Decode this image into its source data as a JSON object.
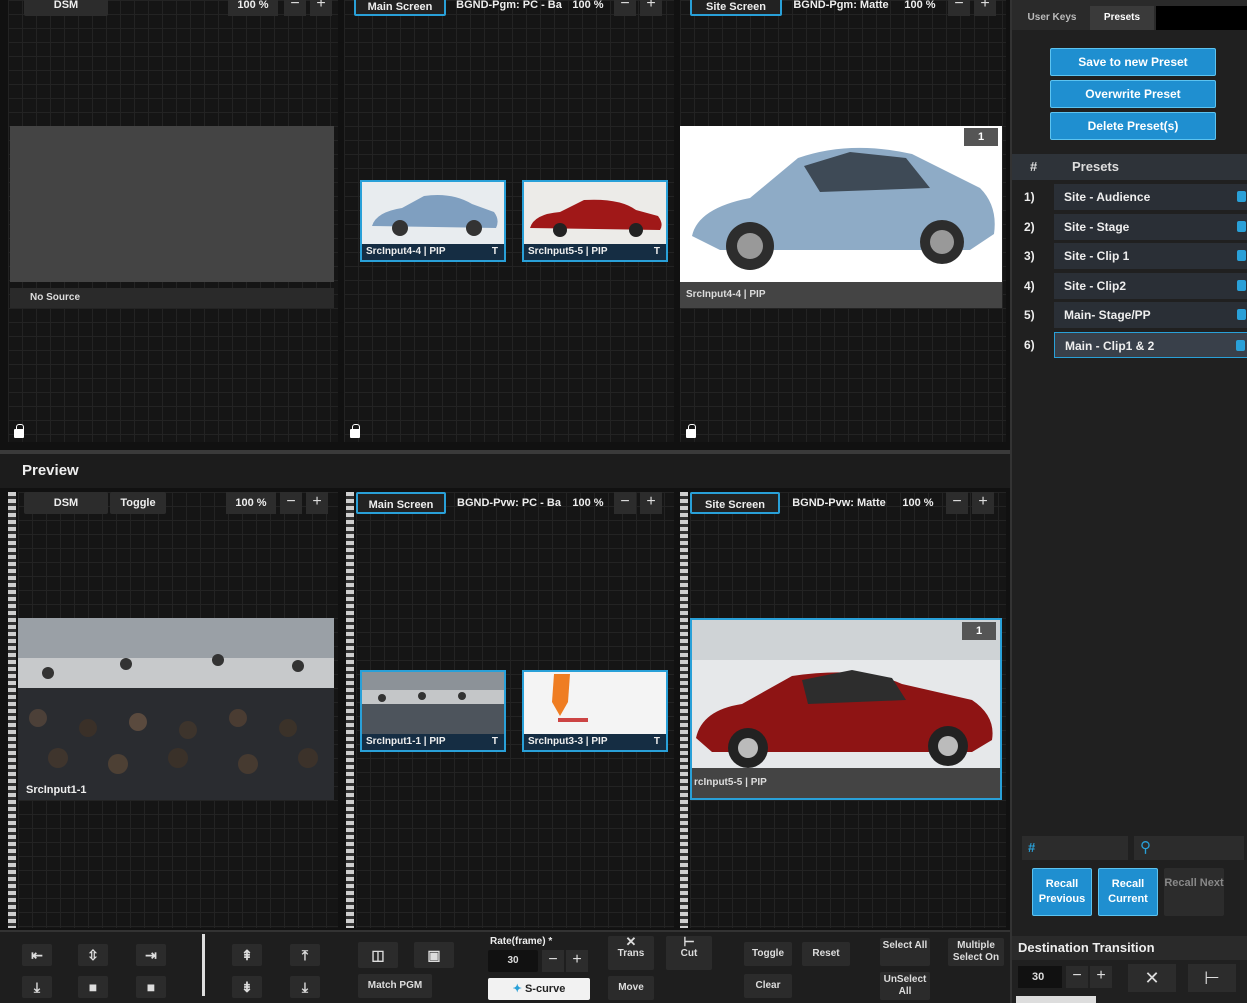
{
  "program": {
    "panels": [
      {
        "screen": "DSM",
        "zoom": "100 %",
        "nosource": "No Source"
      },
      {
        "screen": "Main Screen",
        "bgnd": "BGND-Pgm: PC - Ba",
        "zoom": "100 %",
        "pips": [
          {
            "label": "SrcInput4-4 | PIP",
            "t": "T"
          },
          {
            "label": "SrcInput5-5 | PIP",
            "t": "T"
          }
        ]
      },
      {
        "screen": "Site Screen",
        "bgnd": "BGND-Pgm: Matte",
        "zoom": "100 %",
        "layer_num": "1",
        "label": "SrcInput4-4 | PIP"
      }
    ]
  },
  "preview": {
    "title": "Preview",
    "panels": [
      {
        "screen": "DSM",
        "toggle": "Toggle",
        "zoom": "100 %",
        "label": "SrcInput1-1"
      },
      {
        "screen": "Main Screen",
        "bgnd": "BGND-Pvw: PC - Ba",
        "zoom": "100 %",
        "pips": [
          {
            "label": "SrcInput1-1 | PIP",
            "t": "T"
          },
          {
            "label": "SrcInput3-3 | PIP",
            "t": "T"
          }
        ]
      },
      {
        "screen": "Site Screen",
        "bgnd": "BGND-Pvw: Matte",
        "zoom": "100 %",
        "layer_num": "1",
        "label": "rcInput5-5 | PIP"
      }
    ]
  },
  "right_panel": {
    "tabs": [
      "User Keys",
      "Presets"
    ],
    "active_tab": "Presets",
    "buttons": {
      "save": "Save to new Preset",
      "overwrite": "Overwrite Preset",
      "delete": "Delete Preset(s)"
    },
    "list_header": {
      "hash": "#",
      "title": "Presets"
    },
    "presets": [
      {
        "num": "1)",
        "name": "Site - Audience"
      },
      {
        "num": "2)",
        "name": "Site - Stage"
      },
      {
        "num": "3)",
        "name": "Site - Clip 1"
      },
      {
        "num": "4)",
        "name": "Site - Clip2"
      },
      {
        "num": "5)",
        "name": "Main- Stage/PP"
      },
      {
        "num": "6)",
        "name": "Main - Clip1 & 2"
      }
    ],
    "selected_preset": 6,
    "recall": {
      "previous": "Recall Previous",
      "current": "Recall Current",
      "next": "Recall Next"
    },
    "dest_transition": {
      "title": "Destination Transition",
      "rate": "30"
    }
  },
  "toolbar": {
    "match_pgm": "Match PGM",
    "rate_label": "Rate(frame) *",
    "rate_value": "30",
    "trans": "Trans",
    "cut": "Cut",
    "move": "Move",
    "scurve": "S-curve",
    "toggle": "Toggle",
    "reset": "Reset",
    "clear": "Clear",
    "select_all": "Select All",
    "multiple_select_on": "Multiple Select On",
    "unselect_all": "UnSelect All"
  },
  "colors": {
    "accent": "#29a0d8",
    "button_blue": "#1f8fd0",
    "background": "#1a1a1a"
  }
}
